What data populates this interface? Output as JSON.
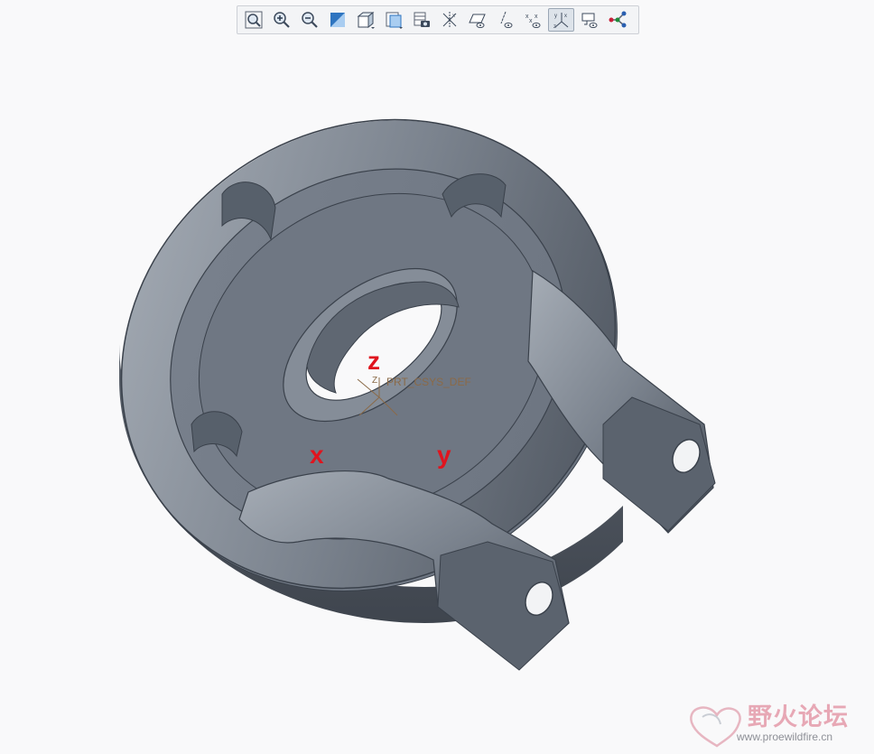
{
  "toolbar": {
    "buttons": [
      {
        "name": "refit-icon",
        "active": false
      },
      {
        "name": "zoom-in-icon",
        "active": false
      },
      {
        "name": "zoom-out-icon",
        "active": false
      },
      {
        "name": "repaint-icon",
        "active": false
      },
      {
        "name": "display-style-icon",
        "active": false
      },
      {
        "name": "saved-orientations-icon",
        "active": false
      },
      {
        "name": "view-manager-icon",
        "active": false
      },
      {
        "name": "perspective-icon",
        "active": false
      },
      {
        "name": "plane-display-icon",
        "active": false
      },
      {
        "name": "axis-display-icon",
        "active": false
      },
      {
        "name": "point-display-icon",
        "active": false
      },
      {
        "name": "csys-display-icon",
        "active": true
      },
      {
        "name": "annotation-display-icon",
        "active": false
      },
      {
        "name": "spin-center-icon",
        "active": false
      }
    ]
  },
  "viewport": {
    "csys_name": "PRT_CSYS_DEF",
    "csys_axis_letter": "Z",
    "axis_labels": {
      "z": "z",
      "x": "x",
      "y": "y"
    },
    "model_color": "#6b737f",
    "annotation_color": "#e0141e"
  },
  "watermark": {
    "title": "野火论坛",
    "url": "www.proewildfire.cn"
  }
}
